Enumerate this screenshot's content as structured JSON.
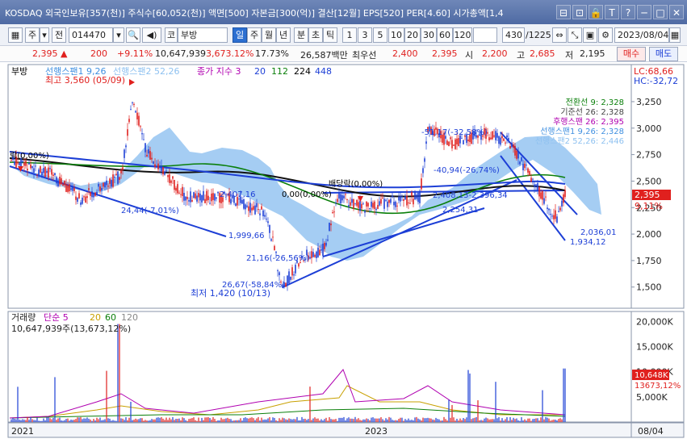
{
  "window": {
    "title": "KOSDAQ 외국인보유[357(천)] 주식수[60,052(천)] 액면[500] 자본금[300(억)] 결산[12월] EPS[520] PER[4.60] 시가총액[1,4",
    "buttons": [
      "⊟",
      "⊡",
      "🔒",
      "T",
      "?",
      "─",
      "□",
      "✕"
    ]
  },
  "toolbar": {
    "grid_icon": "▦",
    "type_label": "주",
    "dropdown_arrow": "▾",
    "prev_label": "전",
    "code": "014470",
    "search_icon": "🔍",
    "sound_icon": "◀)",
    "market_label": "코",
    "stock_name": "부방",
    "periods": [
      "일",
      "주",
      "월",
      "년",
      "분",
      "초",
      "틱"
    ],
    "intervals": [
      "1",
      "3",
      "5",
      "10",
      "20",
      "30",
      "60",
      "120"
    ],
    "count": "430",
    "total": "/1225",
    "date": "2023/08/04"
  },
  "quote": {
    "price": "2,395 ▲",
    "change": "200",
    "change_pct": "+9.11%",
    "volume": "10,647,939",
    "volume_pct": "3,673.12%",
    "turnover": "17.73%",
    "amount": "26,587백만",
    "best_quote_label": "최우선",
    "best_ask": "2,400",
    "best_bid": "2,395",
    "open_label": "시",
    "open": "2,200",
    "high_label": "고",
    "high": "2,685",
    "low_label": "저",
    "low": "2,195",
    "buy_label": "매수",
    "sell_label": "매도"
  },
  "chart_data": [
    {
      "type": "candlestick",
      "title": "",
      "legend": [
        {
          "name": "부방",
          "color": "#000000"
        },
        {
          "name": "선행스팬1 9,26",
          "color": "#3f8fe0"
        },
        {
          "name": "선행스팬2 52,26",
          "color": "#8ec1f0"
        },
        {
          "name": "종가 지수 3",
          "color": "#b000b0"
        },
        {
          "name": "20",
          "color": "#1d3fd6"
        },
        {
          "name": "112",
          "color": "#0a7f0a"
        },
        {
          "name": "224",
          "color": "#000000"
        },
        {
          "name": "448",
          "color": "#1d3fd6"
        }
      ],
      "y_ticks": [
        "3,250",
        "3,000",
        "2,750",
        "2,500",
        "2,250",
        "2,000",
        "1,750",
        "1,500"
      ],
      "ylim": [
        1300,
        3600
      ],
      "x_labels": [
        "2021",
        "2023"
      ],
      "current_price_label": "2,395",
      "current_pct_label": "9,11%",
      "lc_label": "LC:68,66",
      "hc_label": "HC:-32,72",
      "ichimoku_labels": [
        "전환선 9: 2,328",
        "기준선 26: 2,328",
        "후행스팬 26: 2,395",
        "선행스팬1 9,26: 2,328",
        "선행스팬2 52,26: 2,446"
      ],
      "annotations": [
        "최고 3,560 (05/09)",
        "최저 1,420 (10/13)",
        "24,44(-7,01%)",
        "1,999,66",
        "2,407,16",
        "0,00(0,00%)",
        "배당락(0,00%)",
        "21,16(-26,56%)",
        "26,67(-58,84%)",
        "-51,17(-32,58%)",
        "-40,94(-26,74%)",
        "2,408,13-2,396,34",
        "2,254,31",
        "2,036,01",
        "1,934,12",
        "락(0,00%)"
      ]
    },
    {
      "type": "bar",
      "legend": [
        {
          "name": "거래량",
          "color": "#222222"
        },
        {
          "name": "단순 5",
          "color": "#b000b0"
        },
        {
          "name": "20",
          "color": "#c8a000"
        },
        {
          "name": "60",
          "color": "#0a7f0a"
        },
        {
          "name": "120",
          "color": "#888888"
        }
      ],
      "volume_label": "10,647,939주(13,673,12%)",
      "y_ticks": [
        "20,000K",
        "15,000K",
        "10,000K",
        "5,000K"
      ],
      "ylim": [
        0,
        22000
      ],
      "current_volume_label": "10,648K",
      "current_volume_pct": "13673,12%",
      "x_labels": [
        "2021",
        "2023"
      ],
      "date_label": "08/04"
    }
  ]
}
